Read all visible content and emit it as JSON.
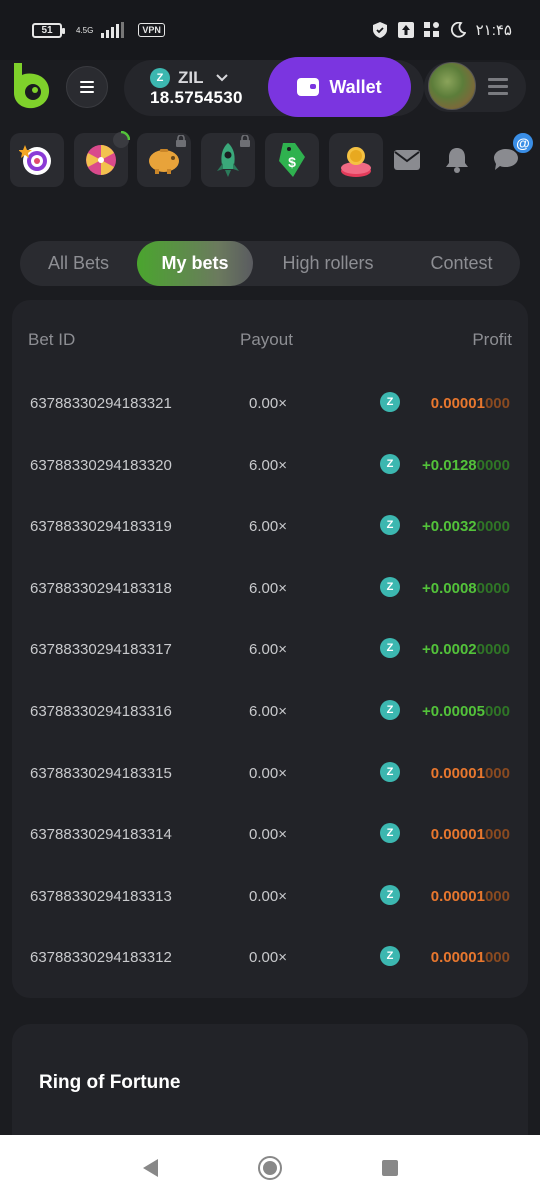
{
  "status_bar": {
    "battery": "51",
    "network": "4.5G",
    "vpn": "VPN",
    "time": "۲۱:۴۵"
  },
  "header": {
    "currency": "ZIL",
    "balance": "18.5754530",
    "wallet_label": "Wallet"
  },
  "quick_icons": [
    {
      "name": "target-icon",
      "locked": false
    },
    {
      "name": "wheel-icon",
      "locked": false
    },
    {
      "name": "piggy-bank-icon",
      "locked": true
    },
    {
      "name": "rocket-icon",
      "locked": true
    },
    {
      "name": "dollar-tag-icon",
      "locked": false
    },
    {
      "name": "coin-icon",
      "locked": false
    }
  ],
  "tabs": [
    "All Bets",
    "My bets",
    "High rollers",
    "Contest"
  ],
  "active_tab": "My bets",
  "bets": {
    "columns": {
      "bet_id": "Bet ID",
      "payout": "Payout",
      "profit": "Profit"
    },
    "rows": [
      {
        "bet_id": "63788330294183321",
        "payout": "0.00×",
        "profit_lead": "0.00001",
        "profit_trail": "000",
        "sign": "neg"
      },
      {
        "bet_id": "63788330294183320",
        "payout": "6.00×",
        "profit_lead": "+0.0128",
        "profit_trail": "0000",
        "sign": "pos"
      },
      {
        "bet_id": "63788330294183319",
        "payout": "6.00×",
        "profit_lead": "+0.0032",
        "profit_trail": "0000",
        "sign": "pos"
      },
      {
        "bet_id": "63788330294183318",
        "payout": "6.00×",
        "profit_lead": "+0.0008",
        "profit_trail": "0000",
        "sign": "pos"
      },
      {
        "bet_id": "63788330294183317",
        "payout": "6.00×",
        "profit_lead": "+0.0002",
        "profit_trail": "0000",
        "sign": "pos"
      },
      {
        "bet_id": "63788330294183316",
        "payout": "6.00×",
        "profit_lead": "+0.00005",
        "profit_trail": "000",
        "sign": "pos"
      },
      {
        "bet_id": "63788330294183315",
        "payout": "0.00×",
        "profit_lead": "0.00001",
        "profit_trail": "000",
        "sign": "neg"
      },
      {
        "bet_id": "63788330294183314",
        "payout": "0.00×",
        "profit_lead": "0.00001",
        "profit_trail": "000",
        "sign": "neg"
      },
      {
        "bet_id": "63788330294183313",
        "payout": "0.00×",
        "profit_lead": "0.00001",
        "profit_trail": "000",
        "sign": "neg"
      },
      {
        "bet_id": "63788330294183312",
        "payout": "0.00×",
        "profit_lead": "0.00001",
        "profit_trail": "000",
        "sign": "neg"
      }
    ]
  },
  "section": {
    "title": "Ring of Fortune"
  },
  "colors": {
    "accent": "#7b35e0",
    "profit_positive": "#53c23a",
    "profit_negative": "#e8772e",
    "coin": "#3cb7b0"
  }
}
